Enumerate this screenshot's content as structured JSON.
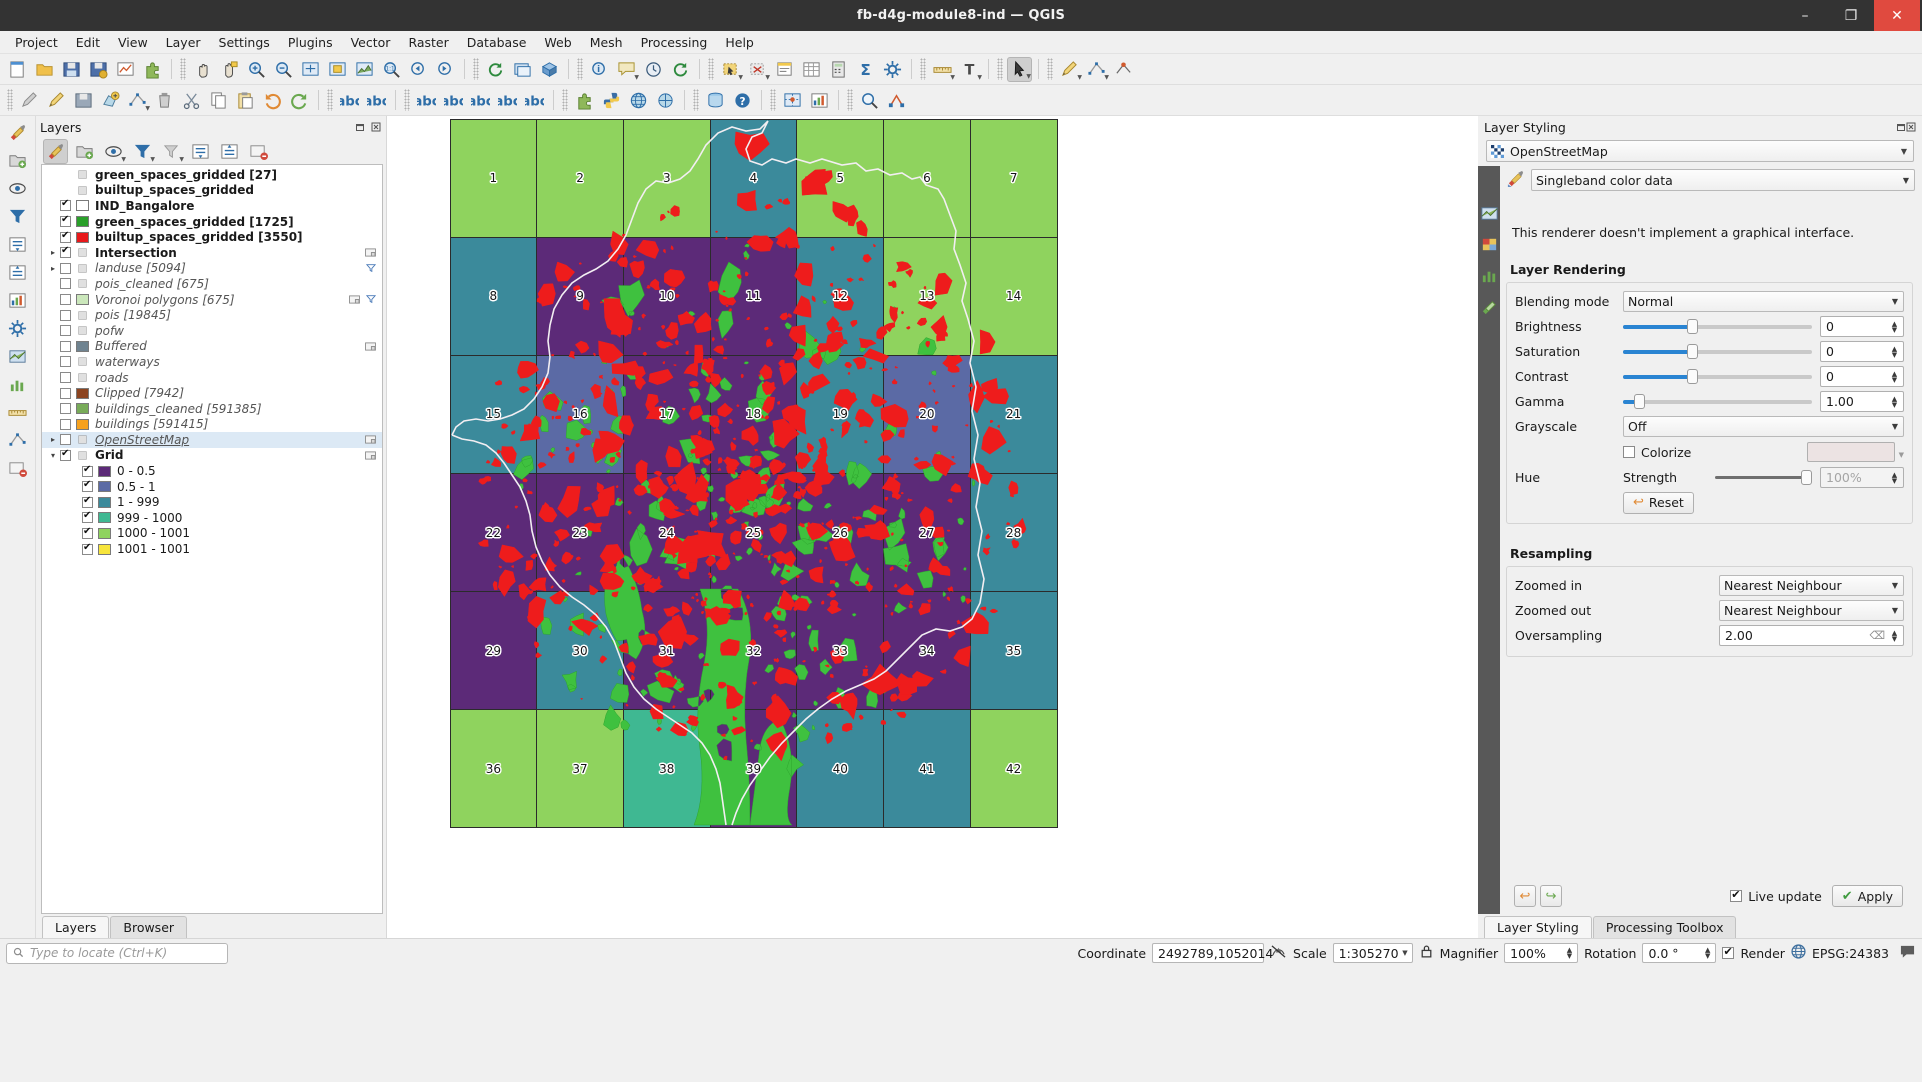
{
  "window": {
    "title": "fb-d4g-module8-ind — QGIS",
    "minimize": "–",
    "maximize": "❐",
    "close": "✕"
  },
  "menubar": [
    "Project",
    "Edit",
    "View",
    "Layer",
    "Settings",
    "Plugins",
    "Vector",
    "Raster",
    "Database",
    "Web",
    "Mesh",
    "Processing",
    "Help"
  ],
  "layers_panel": {
    "title": "Layers",
    "toolbar_icons": [
      "open-layer-styling-panel-icon",
      "add-group-icon",
      "manage-map-themes-icon",
      "filter-legend-icon",
      "filter-legend-expression-icon",
      "expand-all-icon",
      "collapse-all-icon",
      "remove-layer-icon"
    ],
    "items": [
      {
        "label": "green_spaces_gridded [27]",
        "checkbox": "none",
        "swatch": "table-icon",
        "bold": true,
        "italic": false,
        "expander": ""
      },
      {
        "label": "builtup_spaces_gridded",
        "checkbox": "none",
        "swatch": "table-icon",
        "bold": true,
        "italic": false,
        "expander": ""
      },
      {
        "label": "IND_Bangalore",
        "checkbox": "checked",
        "swatch": "#ffffff",
        "bold": true,
        "italic": false,
        "expander": ""
      },
      {
        "label": "green_spaces_gridded [1725]",
        "checkbox": "checked",
        "swatch": "#2aa02a",
        "bold": true,
        "italic": false,
        "expander": ""
      },
      {
        "label": "builtup_spaces_gridded [3550]",
        "checkbox": "checked",
        "swatch": "#e8191b",
        "bold": true,
        "italic": false,
        "expander": ""
      },
      {
        "label": "Intersection",
        "checkbox": "checked",
        "swatch": "polygon-icon",
        "bold": true,
        "italic": false,
        "expander": "▸"
      },
      {
        "label": "landuse [5094]",
        "checkbox": "unchecked",
        "swatch": "polygon-icon",
        "bold": false,
        "italic": true,
        "expander": "▸"
      },
      {
        "label": "pois_cleaned [675]",
        "checkbox": "unchecked",
        "swatch": "point-blue-icon",
        "bold": false,
        "italic": true,
        "expander": ""
      },
      {
        "label": "Voronoi polygons [675]",
        "checkbox": "unchecked",
        "swatch": "#cbe7bb",
        "bold": false,
        "italic": true,
        "expander": ""
      },
      {
        "label": "pois [19845]",
        "checkbox": "unchecked",
        "swatch": "point-brown-icon",
        "bold": false,
        "italic": true,
        "expander": ""
      },
      {
        "label": "pofw",
        "checkbox": "unchecked",
        "swatch": "point-brown-icon",
        "bold": false,
        "italic": true,
        "expander": ""
      },
      {
        "label": "Buffered",
        "checkbox": "unchecked",
        "swatch": "#6f8390",
        "bold": false,
        "italic": true,
        "expander": ""
      },
      {
        "label": "waterways",
        "checkbox": "unchecked",
        "swatch": "line-blue-icon",
        "bold": false,
        "italic": true,
        "expander": ""
      },
      {
        "label": "roads",
        "checkbox": "unchecked",
        "swatch": "line-dark-icon",
        "bold": false,
        "italic": true,
        "expander": ""
      },
      {
        "label": "Clipped [7942]",
        "checkbox": "unchecked",
        "swatch": "#8c4420",
        "bold": false,
        "italic": true,
        "expander": ""
      },
      {
        "label": "buildings_cleaned [591385]",
        "checkbox": "unchecked",
        "swatch": "#78ab59",
        "bold": false,
        "italic": true,
        "expander": ""
      },
      {
        "label": "buildings [591415]",
        "checkbox": "unchecked",
        "swatch": "#f6a11e",
        "bold": false,
        "italic": true,
        "expander": ""
      },
      {
        "label": "OpenStreetMap",
        "checkbox": "unchecked",
        "swatch": "raster-icon",
        "bold": false,
        "italic": true,
        "expander": "▸",
        "selected": true
      },
      {
        "label": "Grid",
        "checkbox": "checked",
        "swatch": "polygon-icon",
        "bold": true,
        "italic": false,
        "expander": "▾"
      }
    ],
    "grid_classes": [
      {
        "label": "0 - 0.5",
        "color": "#5c2a78",
        "checked": true
      },
      {
        "label": "0.5 - 1",
        "color": "#5b6aa5",
        "checked": true
      },
      {
        "label": "1 - 999",
        "color": "#3b8a9b",
        "checked": true
      },
      {
        "label": "999 - 1000",
        "color": "#3fb892",
        "checked": true
      },
      {
        "label": "1000 - 1001",
        "color": "#8fd35e",
        "checked": true
      },
      {
        "label": "1001 - 1001",
        "color": "#f7e53c",
        "checked": true
      }
    ],
    "tabs": [
      {
        "label": "Layers",
        "active": true
      },
      {
        "label": "Browser",
        "active": false
      }
    ]
  },
  "map": {
    "cells": [
      {
        "n": "1",
        "c": "#8fd35e"
      },
      {
        "n": "8",
        "c": "#3b8a9b"
      },
      {
        "n": "15",
        "c": "#3b8a9b"
      },
      {
        "n": "22",
        "c": "#5c2a78"
      },
      {
        "n": "29",
        "c": "#5c2a78"
      },
      {
        "n": "36",
        "c": "#8fd35e"
      },
      {
        "n": "",
        "c": "#8fd35e"
      },
      {
        "n": "2",
        "c": "#8fd35e"
      },
      {
        "n": "9",
        "c": "#5c2a78"
      },
      {
        "n": "16",
        "c": "#5b6aa5"
      },
      {
        "n": "23",
        "c": "#5c2a78"
      },
      {
        "n": "30",
        "c": "#3b8a9b"
      },
      {
        "n": "37",
        "c": "#8fd35e"
      },
      {
        "n": "",
        "c": "#8fd35e"
      },
      {
        "n": "3",
        "c": "#8fd35e"
      },
      {
        "n": "10",
        "c": "#5c2a78"
      },
      {
        "n": "17",
        "c": "#5c2a78"
      },
      {
        "n": "24",
        "c": "#5c2a78"
      },
      {
        "n": "31",
        "c": "#5c2a78"
      },
      {
        "n": "38",
        "c": "#3fb892"
      },
      {
        "n": "",
        "c": "#8fd35e"
      },
      {
        "n": "4",
        "c": "#3b8a9b"
      },
      {
        "n": "11",
        "c": "#5c2a78"
      },
      {
        "n": "18",
        "c": "#5c2a78"
      },
      {
        "n": "25",
        "c": "#5c2a78"
      },
      {
        "n": "32",
        "c": "#5c2a78"
      },
      {
        "n": "39",
        "c": "#5c2a78"
      },
      {
        "n": "",
        "c": "#8fd35e"
      },
      {
        "n": "5",
        "c": "#8fd35e"
      },
      {
        "n": "12",
        "c": "#3b8a9b"
      },
      {
        "n": "19",
        "c": "#3b8a9b"
      },
      {
        "n": "26",
        "c": "#5c2a78"
      },
      {
        "n": "33",
        "c": "#5c2a78"
      },
      {
        "n": "40",
        "c": "#3b8a9b"
      },
      {
        "n": "",
        "c": "#8fd35e"
      },
      {
        "n": "6",
        "c": "#8fd35e"
      },
      {
        "n": "13",
        "c": "#8fd35e"
      },
      {
        "n": "20",
        "c": "#5b6aa5"
      },
      {
        "n": "27",
        "c": "#5c2a78"
      },
      {
        "n": "34",
        "c": "#5c2a78"
      },
      {
        "n": "41",
        "c": "#3b8a9b"
      },
      {
        "n": "",
        "c": "#8fd35e"
      },
      {
        "n": "7",
        "c": "#8fd35e"
      },
      {
        "n": "14",
        "c": "#8fd35e"
      },
      {
        "n": "21",
        "c": "#3b8a9b"
      },
      {
        "n": "28",
        "c": "#3b8a9b"
      },
      {
        "n": "35",
        "c": "#3b8a9b"
      },
      {
        "n": "42",
        "c": "#8fd35e"
      },
      {
        "n": "",
        "c": "#8fd35e"
      }
    ],
    "colors": {
      "builtup": "#ee1c1c",
      "green": "#3fc13f",
      "boundary": "#f2eef2",
      "cell_border": "#2b2b2b"
    }
  },
  "styling_panel": {
    "title": "Layer Styling",
    "layer_name": "OpenStreetMap",
    "renderer": "Singleband color data",
    "note": "This renderer doesn't implement a graphical interface.",
    "layer_rendering": {
      "title": "Layer Rendering",
      "blending_mode_label": "Blending mode",
      "blending_mode": "Normal",
      "brightness_label": "Brightness",
      "brightness": "0",
      "saturation_label": "Saturation",
      "saturation": "0",
      "contrast_label": "Contrast",
      "contrast": "0",
      "gamma_label": "Gamma",
      "gamma": "1.00",
      "grayscale_label": "Grayscale",
      "grayscale": "Off",
      "hue_label": "Hue",
      "colorize_label": "Colorize",
      "colorize_checked": false,
      "strength_label": "Strength",
      "strength": "100%",
      "reset_label": "Reset"
    },
    "resampling": {
      "title": "Resampling",
      "zoomed_in_label": "Zoomed in",
      "zoomed_in": "Nearest Neighbour",
      "zoomed_out_label": "Zoomed out",
      "zoomed_out": "Nearest Neighbour",
      "oversampling_label": "Oversampling",
      "oversampling": "2.00"
    },
    "live_update_label": "Live update",
    "live_update_checked": true,
    "apply_label": "Apply",
    "tabs": [
      {
        "label": "Layer Styling",
        "active": true
      },
      {
        "label": "Processing Toolbox",
        "active": false
      }
    ]
  },
  "statusbar": {
    "locator_placeholder": "Type to locate (Ctrl+K)",
    "coordinate_label": "Coordinate",
    "coordinate": "2492789,1052014",
    "scale_label": "Scale",
    "scale": "1:305270",
    "magnifier_label": "Magnifier",
    "magnifier": "100%",
    "rotation_label": "Rotation",
    "rotation": "0.0 °",
    "render_label": "Render",
    "render_checked": true,
    "crs": "EPSG:24383"
  }
}
